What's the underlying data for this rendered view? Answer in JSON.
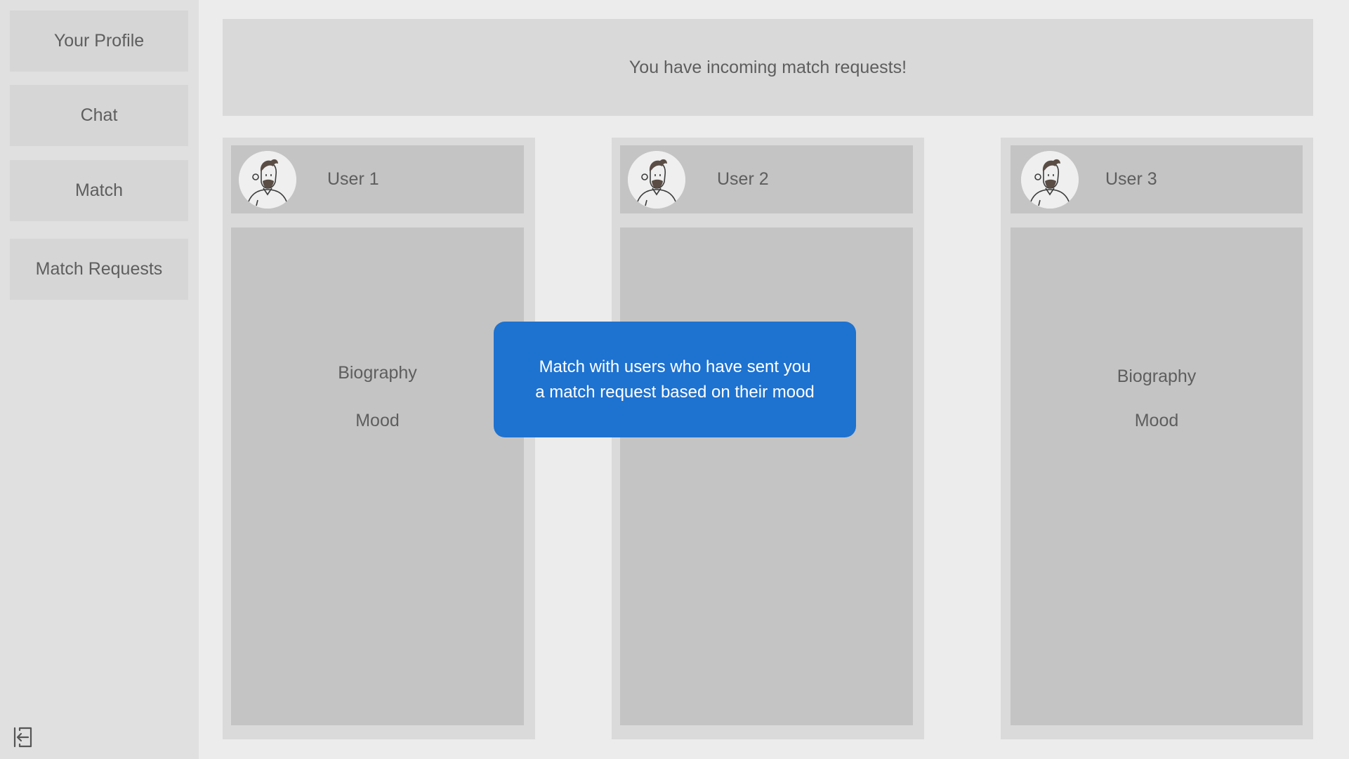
{
  "sidebar": {
    "items": [
      {
        "label": "Your Profile"
      },
      {
        "label": "Chat"
      },
      {
        "label": "Match"
      },
      {
        "label": "Match Requests"
      }
    ],
    "logout_icon": "logout-icon"
  },
  "banner": {
    "text": "You have incoming match requests!"
  },
  "cards": [
    {
      "name": "User 1",
      "biography": "Biography",
      "mood": "Mood",
      "avatar_icon": "user-avatar-icon"
    },
    {
      "name": "User 2",
      "avatar_icon": "user-avatar-icon"
    },
    {
      "name": "User 3",
      "biography": "Biography",
      "mood": "Mood",
      "avatar_icon": "user-avatar-icon"
    }
  ],
  "tooltip": {
    "line1": "Match with users who have sent you",
    "line2": "a match request based on their mood"
  },
  "colors": {
    "accent": "#1e72d0",
    "sidebar_bg": "#e0e0e0",
    "card_bg": "#c4c4c4"
  }
}
